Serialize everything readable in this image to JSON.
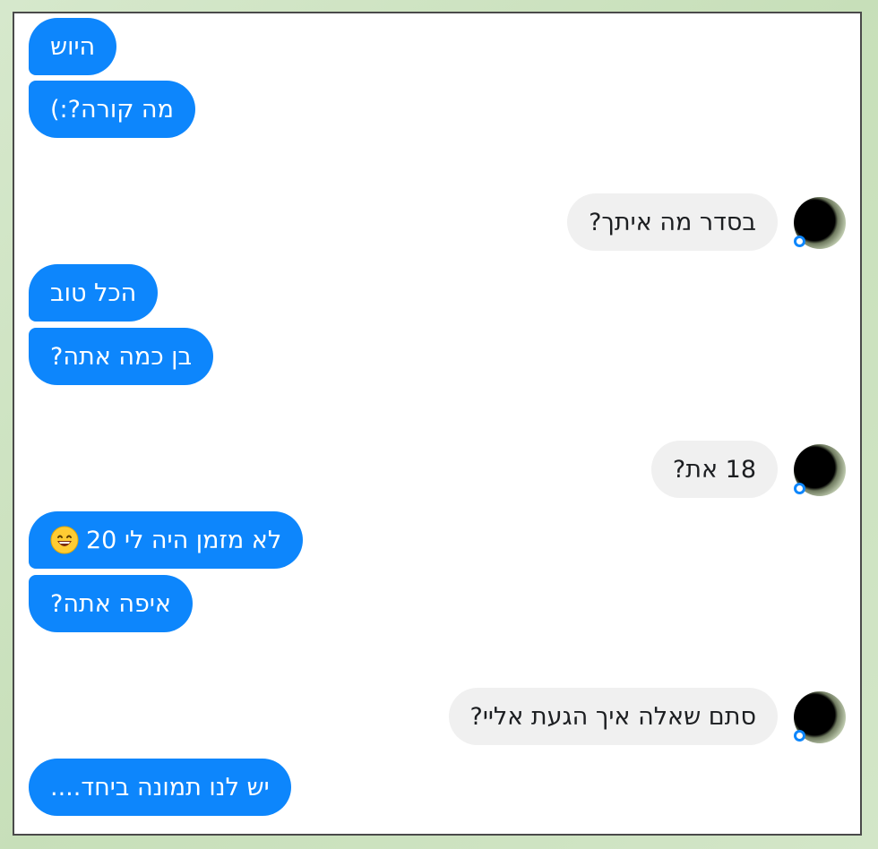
{
  "messages": {
    "m1": "היוש",
    "m2": "מה קורה?:)",
    "m3": "בסדר מה איתך?",
    "m4": "הכל טוב",
    "m5": "בן כמה אתה?",
    "m6": "18 את?",
    "m7": "לא מזמן היה לי 20",
    "m8": "איפה אתה?",
    "m9": "סתם שאלה איך הגעת אליי?",
    "m10": "יש לנו תמונה ביחד...."
  },
  "colors": {
    "sent_bubble": "#0d86fc",
    "received_bubble": "#f0f0f0",
    "frame_border": "#4a4a4a"
  },
  "icons": {
    "avatar": "contact-avatar",
    "status": "seen-indicator-icon",
    "emoji": "grinning-face-emoji"
  }
}
